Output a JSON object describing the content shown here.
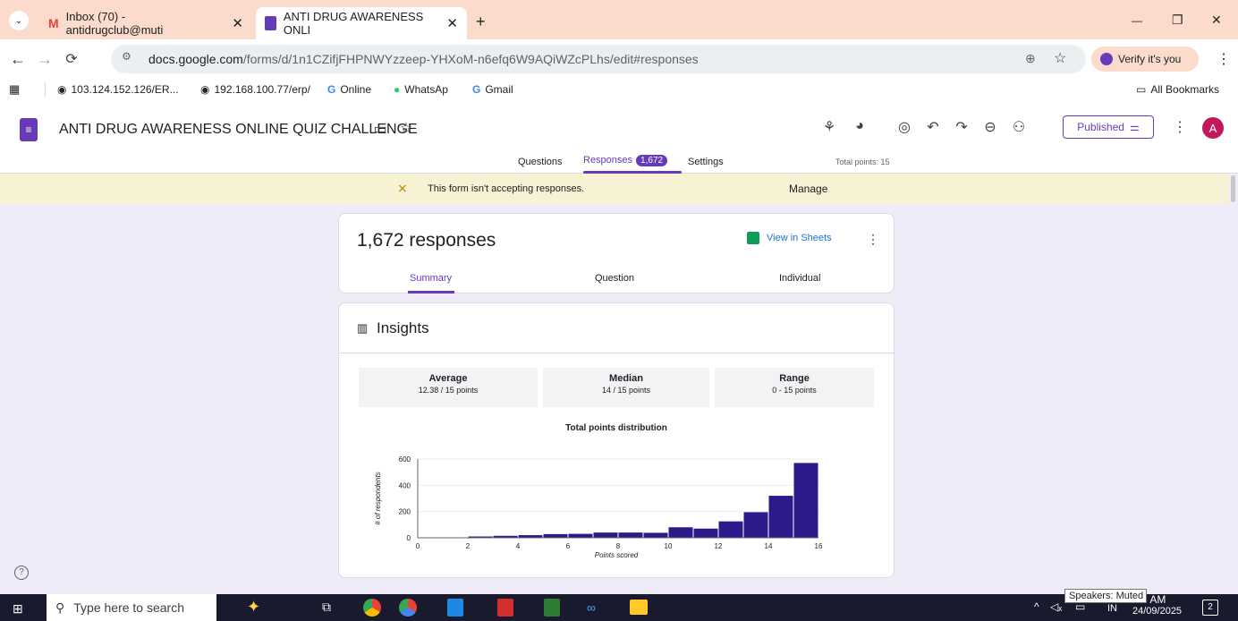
{
  "browser": {
    "tabs": [
      {
        "label": "Inbox (70) - antidrugclub@muti",
        "close": "✕"
      },
      {
        "label": "ANTI DRUG AWARENESS ONLI",
        "close": "✕"
      }
    ],
    "new_tab": "+",
    "window_controls": {
      "min": "—",
      "max": "❐",
      "close": "✕"
    },
    "url_host": "docs.google.com",
    "url_path": "/forms/d/1n1CZifjFHPNWYzzeep-YHXoM-n6efq6W9AQiWZcPLhs/edit#responses",
    "verify_label": "Verify it's you",
    "bookmarks": [
      "103.124.152.126/ER...",
      "192.168.100.77/erp/",
      "Online",
      "WhatsAp",
      "Gmail"
    ],
    "all_bookmarks": "All Bookmarks"
  },
  "form": {
    "title": "ANTI DRUG AWARENESS ONLINE QUIZ CHALLENGE",
    "tabs": {
      "questions": "Questions",
      "responses": "Responses",
      "responses_count": "1,672",
      "settings": "Settings"
    },
    "total_points": "Total points: 15",
    "published": "Published",
    "avatar": "A",
    "notice": "This form isn't accepting responses.",
    "manage": "Manage"
  },
  "responses": {
    "count_label": "1,672 responses",
    "view_sheets": "View in Sheets",
    "subtabs": [
      "Summary",
      "Question",
      "Individual"
    ]
  },
  "insights": {
    "title": "Insights",
    "average_label": "Average",
    "average_value": "12.38 / 15 points",
    "median_label": "Median",
    "median_value": "14 / 15 points",
    "range_label": "Range",
    "range_value": "0 - 15 points"
  },
  "chart_data": {
    "type": "bar",
    "title": "Total points distribution",
    "xlabel": "Points scored",
    "ylabel": "# of respondents",
    "categories": [
      0,
      1,
      2,
      3,
      4,
      5,
      6,
      7,
      8,
      9,
      10,
      11,
      12,
      13,
      14,
      15
    ],
    "values": [
      0,
      0,
      10,
      15,
      20,
      28,
      30,
      40,
      40,
      38,
      80,
      70,
      125,
      195,
      320,
      570
    ],
    "xticks": [
      0,
      2,
      4,
      6,
      8,
      10,
      12,
      14,
      16
    ],
    "yticks": [
      0,
      200,
      400,
      600
    ],
    "ylim": [
      0,
      600
    ],
    "xlim": [
      0,
      16
    ],
    "bar_color": "#2b1a8a"
  },
  "taskbar": {
    "search_placeholder": "Type here to search",
    "tooltip": "Speakers: Muted",
    "time": "8 AM",
    "lang": "IN",
    "date": "24/09/2025",
    "notif": "2"
  },
  "help_icon": "?"
}
